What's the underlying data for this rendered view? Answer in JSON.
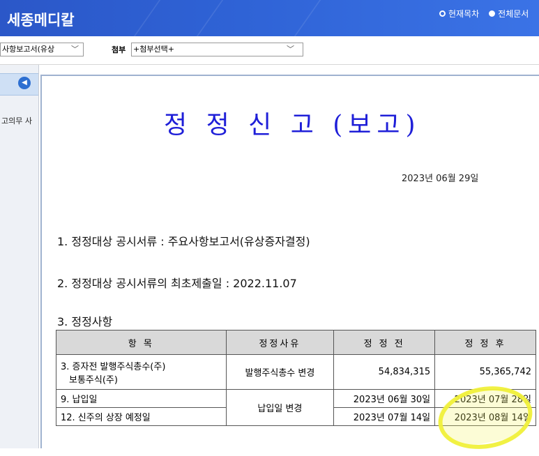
{
  "header": {
    "brand": "세종메디칼",
    "view_options": [
      {
        "label": "현재목차",
        "selected": false
      },
      {
        "label": "전체문서",
        "selected": true
      }
    ]
  },
  "toolbar": {
    "report_select_value": "사항보고서(유상",
    "attach_label": "첨부",
    "attach_select_value": "+첨부선택+"
  },
  "leftpane": {
    "tree_item": "고의무 사"
  },
  "document": {
    "title": "정 정 신 고 (보고)",
    "date": "2023년 06월 29일",
    "item1": "1. 정정대상 공시서류 : 주요사항보고서(유상증자결정)",
    "item2": "2. 정정대상 공시서류의 최초제출일 : 2022.11.07",
    "item3": "3. 정정사항",
    "table": {
      "headers": [
        "항 목",
        "정정사유",
        "정 정 전",
        "정 정 후"
      ],
      "rows": [
        {
          "item": "3. 증자전 발행주식총수(주)",
          "item_sub": "보통주식(주)",
          "reason": "발행주식총수 변경",
          "before": "54,834,315",
          "after": "55,365,742"
        },
        {
          "item": "9. 납입일",
          "reason": "납입일 변경",
          "before": "2023년 06월 30일",
          "after": "2023년 07월 28일"
        },
        {
          "item": "12. 신주의 상장 예정일",
          "before": "2023년 07월 14일",
          "after": "2023년 08월 14일"
        }
      ]
    }
  },
  "colors": {
    "header_blue": "#2f63d6",
    "title_blue": "#1f1fd8",
    "highlight_yellow": "#f0f03a"
  }
}
